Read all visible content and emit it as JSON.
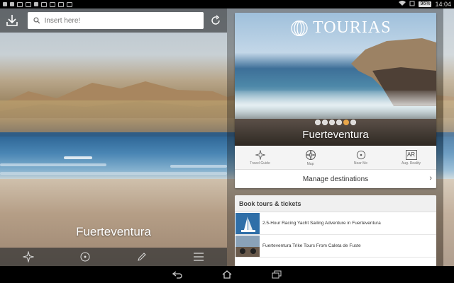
{
  "status_bar": {
    "time": "14:04",
    "battery": "96%"
  },
  "search": {
    "placeholder": "Insert here!"
  },
  "left": {
    "destination_title": "Fuerteventura"
  },
  "card": {
    "brand": "TOURIAS",
    "title": "Fuerteventura",
    "carousel": {
      "total": 6,
      "active": 5
    },
    "nav": [
      {
        "label": "Travel Guide",
        "icon": "star-icon"
      },
      {
        "label": "Map",
        "icon": "compass-icon"
      },
      {
        "label": "Near Me",
        "icon": "target-icon"
      },
      {
        "label": "Aug. Reality",
        "icon": "ar-icon",
        "icon_text": "AR"
      }
    ],
    "manage_label": "Manage destinations"
  },
  "tours": {
    "header": "Book tours & tickets",
    "items": [
      {
        "title": "2.5-Hour Racing Yacht Sailing Adventure in Fuerteventura"
      },
      {
        "title": "Fuerteventura Trike Tours From Caleta de Fuste"
      }
    ]
  },
  "colors": {
    "accent_dot": "#e8a64a",
    "panel_white": "#ffffff"
  }
}
